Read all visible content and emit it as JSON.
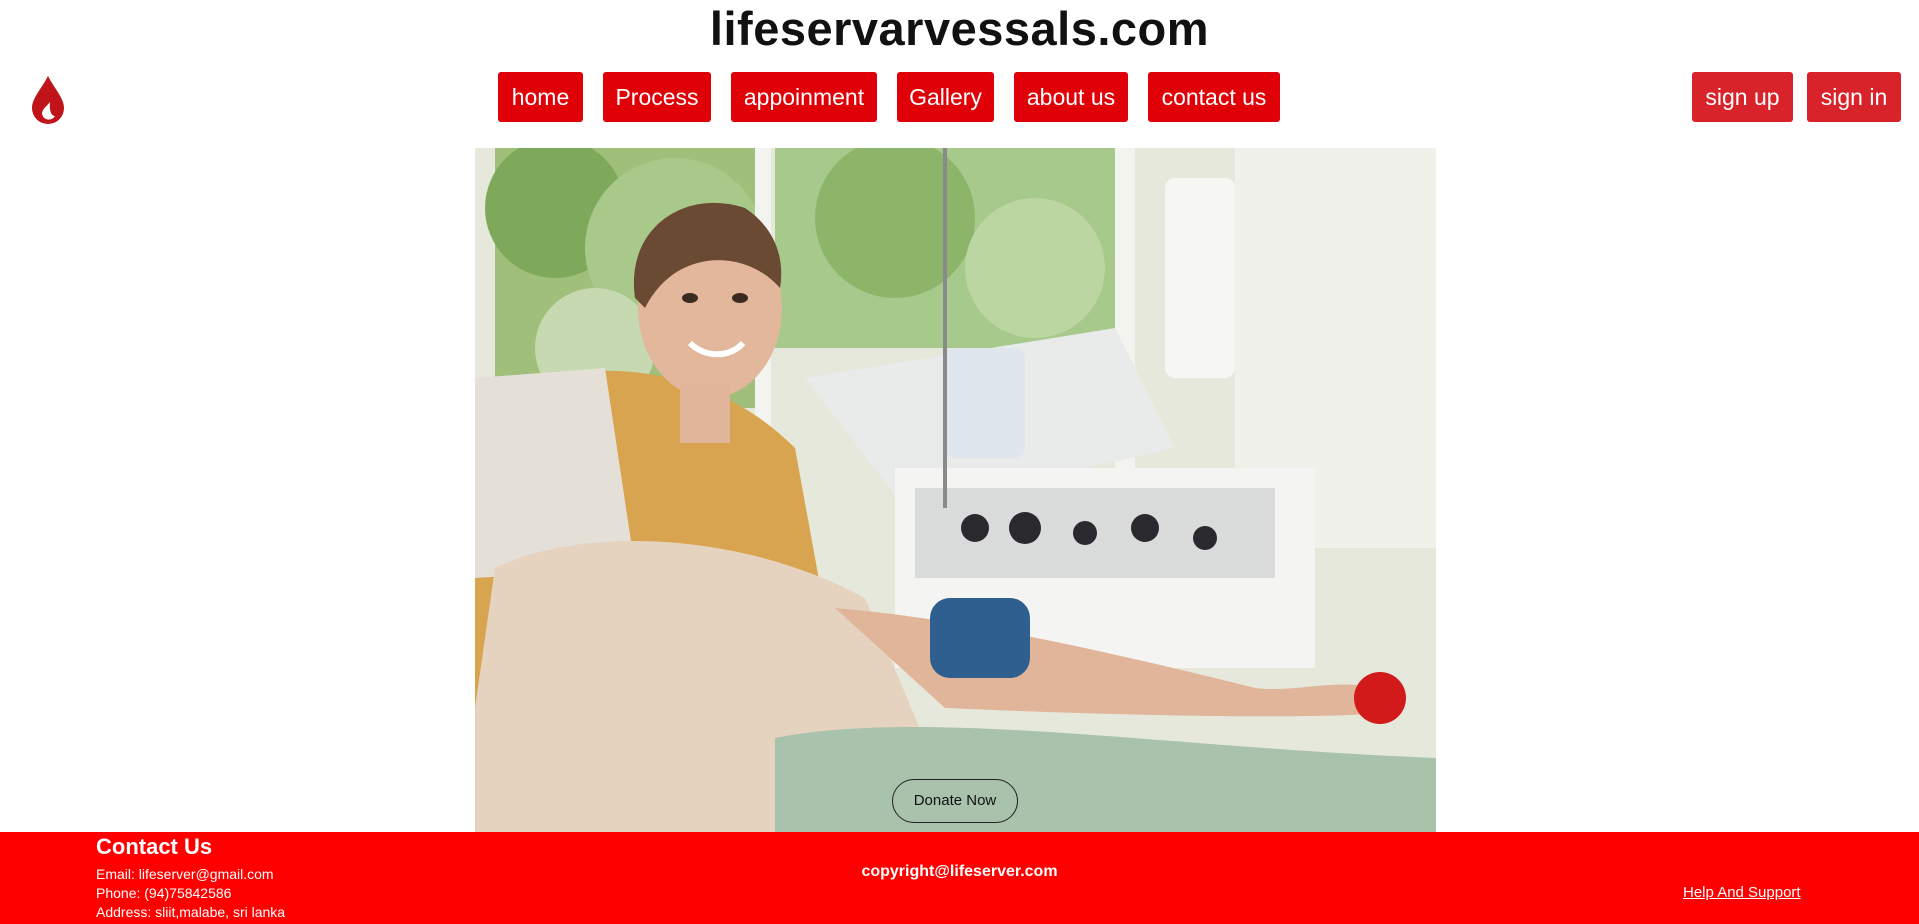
{
  "site": {
    "title": "lifeservarvessals.com"
  },
  "nav": {
    "items": [
      {
        "label": "home"
      },
      {
        "label": "Process"
      },
      {
        "label": "appoinment"
      },
      {
        "label": "Gallery"
      },
      {
        "label": "about us"
      },
      {
        "label": "contact us"
      }
    ]
  },
  "auth": {
    "signup_label": "sign up",
    "signin_label": "sign in"
  },
  "hero": {
    "cta_label": "Donate Now"
  },
  "footer": {
    "heading": "Contact Us",
    "email": "Email: lifeserver@gmail.com",
    "phone": "Phone: (94)75842586",
    "address": "Address: sliit,malabe, sri lanka",
    "copyright": "copyright@lifeserver.com",
    "help_label": "Help And Support"
  },
  "colors": {
    "accent": "#e00008",
    "auth_button": "#d8232a",
    "footer_bg": "#ff0000",
    "logo": "#c0141a"
  },
  "icons": {
    "logo": "blood-drop-icon"
  }
}
